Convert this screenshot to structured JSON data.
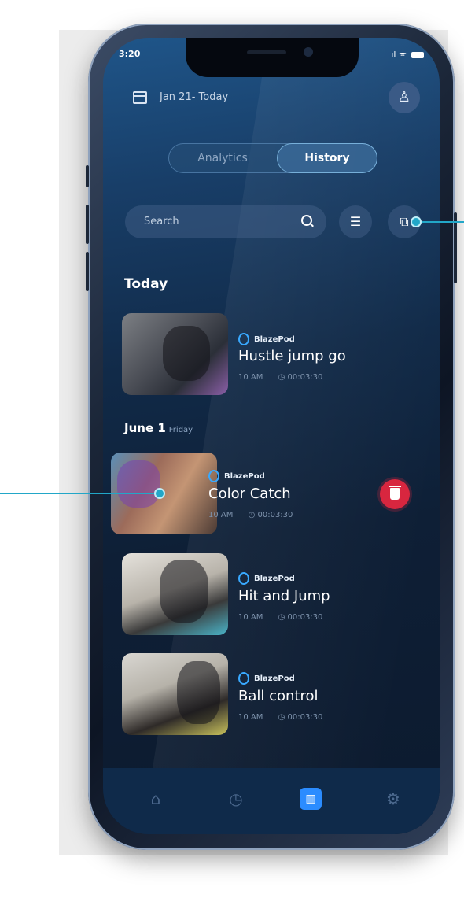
{
  "status_bar": {
    "time": "3:20",
    "signal": "ıl ᯤ"
  },
  "header": {
    "date_range": "Jan 21- Today",
    "avatar_icon": "user-icon"
  },
  "segmented": {
    "tabs": [
      "Analytics",
      "History"
    ],
    "active": "History"
  },
  "search": {
    "placeholder": "Search",
    "icon": "search-icon"
  },
  "actions": {
    "filter_icon": "sliders-icon",
    "export_icon": "external-link-icon"
  },
  "sections": {
    "today": "Today",
    "june_date": "June 1",
    "june_day": "Friday"
  },
  "workouts": [
    {
      "brand": "BlazePod",
      "title": "Hustle jump go",
      "time": "10 AM",
      "duration": "00:03:30"
    },
    {
      "brand": "BlazePod",
      "title": "Color Catch",
      "time": "10 AM",
      "duration": "00:03:30"
    },
    {
      "brand": "BlazePod",
      "title": "Hit and Jump",
      "time": "10 AM",
      "duration": "00:03:30"
    },
    {
      "brand": "BlazePod",
      "title": "Ball control",
      "time": "10 AM",
      "duration": "00:03:30"
    }
  ],
  "tabbar": {
    "items": [
      "home-icon",
      "timer-icon",
      "analytics-icon",
      "settings-icon"
    ],
    "active": "analytics-icon"
  },
  "colors": {
    "accent": "#2b8cff",
    "delete": "#d8263f",
    "callout": "#22a7c8",
    "brand_icon": "#39a9ff"
  }
}
